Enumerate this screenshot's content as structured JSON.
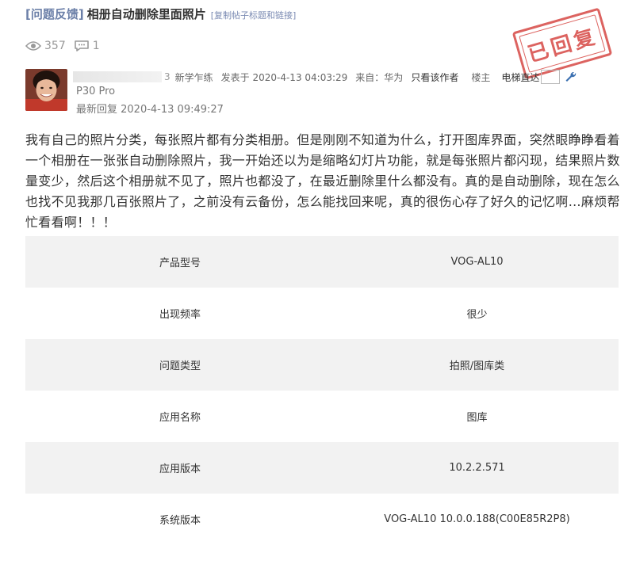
{
  "post": {
    "category": "[问题反馈]",
    "title": "相册自动删除里面照片",
    "copy_link": "[复制帖子标题和链接]",
    "views": "357",
    "replies": "1",
    "stamp": "已回复"
  },
  "author": {
    "name_suffix": "3",
    "rank": "新学乍练",
    "posted": "发表于 2020-4-13 04:03:29",
    "source": "来自：华为",
    "author_only": "只看该作者",
    "floor": "楼主",
    "elevator": "电梯直达",
    "device": "P30 Pro",
    "last_reply": "最新回复 2020-4-13 09:49:27"
  },
  "content": "我有自己的照片分类，每张照片都有分类相册。但是刚刚不知道为什么，打开图库界面，突然眼睁睁看着一个相册在一张张自动删除照片，我一开始还以为是缩略幻灯片功能，就是每张照片都闪现，结果照片数量变少，然后这个相册就不见了，照片也都没了，在最近删除里什么都没有。真的是自动删除，现在怎么也找不见我那几百张照片了，之前没有云备份，怎么能找回来呢，真的很伤心存了好久的记忆啊…麻烦帮忙看看啊！！！",
  "info_rows": [
    {
      "label": "产品型号",
      "value": "VOG-AL10"
    },
    {
      "label": "出现频率",
      "value": "很少"
    },
    {
      "label": "问题类型",
      "value": "拍照/图库类"
    },
    {
      "label": "应用名称",
      "value": "图库"
    },
    {
      "label": "应用版本",
      "value": "10.2.2.571"
    },
    {
      "label": "系统版本",
      "value": "VOG-AL10 10.0.0.188(C00E85R2P8)"
    }
  ],
  "colors": {
    "category": "#6b7fa8",
    "stamp": "#d9534f",
    "link": "#7b8bb3",
    "table_shade": "#f2f2f2"
  },
  "icons": [
    "eye-icon",
    "comment-icon",
    "wrench-icon"
  ]
}
